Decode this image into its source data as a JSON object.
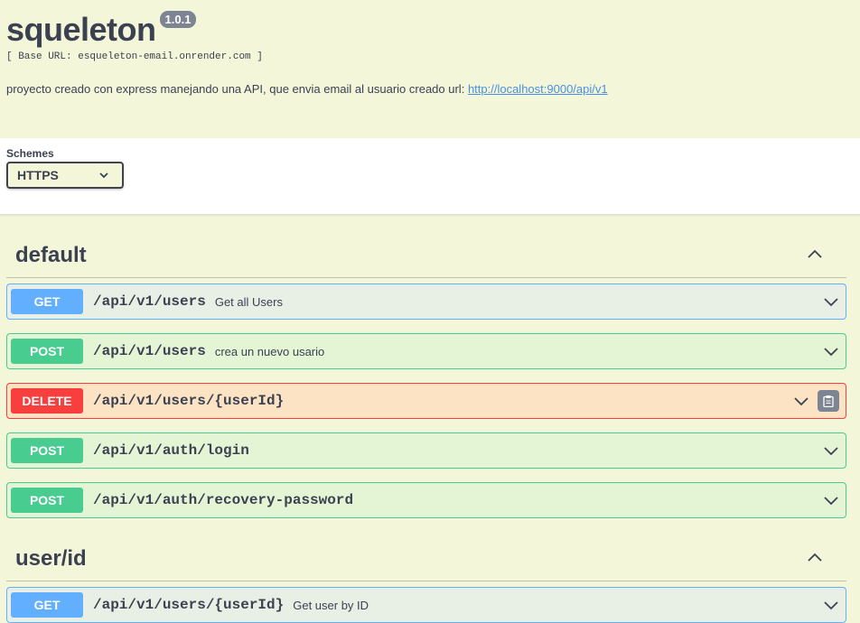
{
  "info": {
    "title": "squeleton",
    "version": "1.0.1",
    "base_url": "[ Base URL: esqueleton-email.onrender.com ]",
    "description": "proyecto creado con express manejando una API, que envia email al usuario creado url:",
    "link": "http://localhost:9000/api/v1"
  },
  "schemes": {
    "label": "Schemes",
    "selected": "HTTPS"
  },
  "tags": [
    {
      "name": "default",
      "operations": [
        {
          "method": "GET",
          "path": "/api/v1/users",
          "summary": "Get all Users"
        },
        {
          "method": "POST",
          "path": "/api/v1/users",
          "summary": "crea un nuevo usario"
        },
        {
          "method": "DELETE",
          "path": "/api/v1/users/{userId}",
          "summary": ""
        },
        {
          "method": "POST",
          "path": "/api/v1/auth/login",
          "summary": ""
        },
        {
          "method": "POST",
          "path": "/api/v1/auth/recovery-password",
          "summary": ""
        }
      ]
    },
    {
      "name": "user/id",
      "operations": [
        {
          "method": "GET",
          "path": "/api/v1/users/{userId}",
          "summary": "Get user by ID"
        }
      ]
    }
  ],
  "colors": {
    "get": "#61affe",
    "post": "#49cc90",
    "delete": "#f93e3e",
    "background": "#f3f6d8"
  }
}
